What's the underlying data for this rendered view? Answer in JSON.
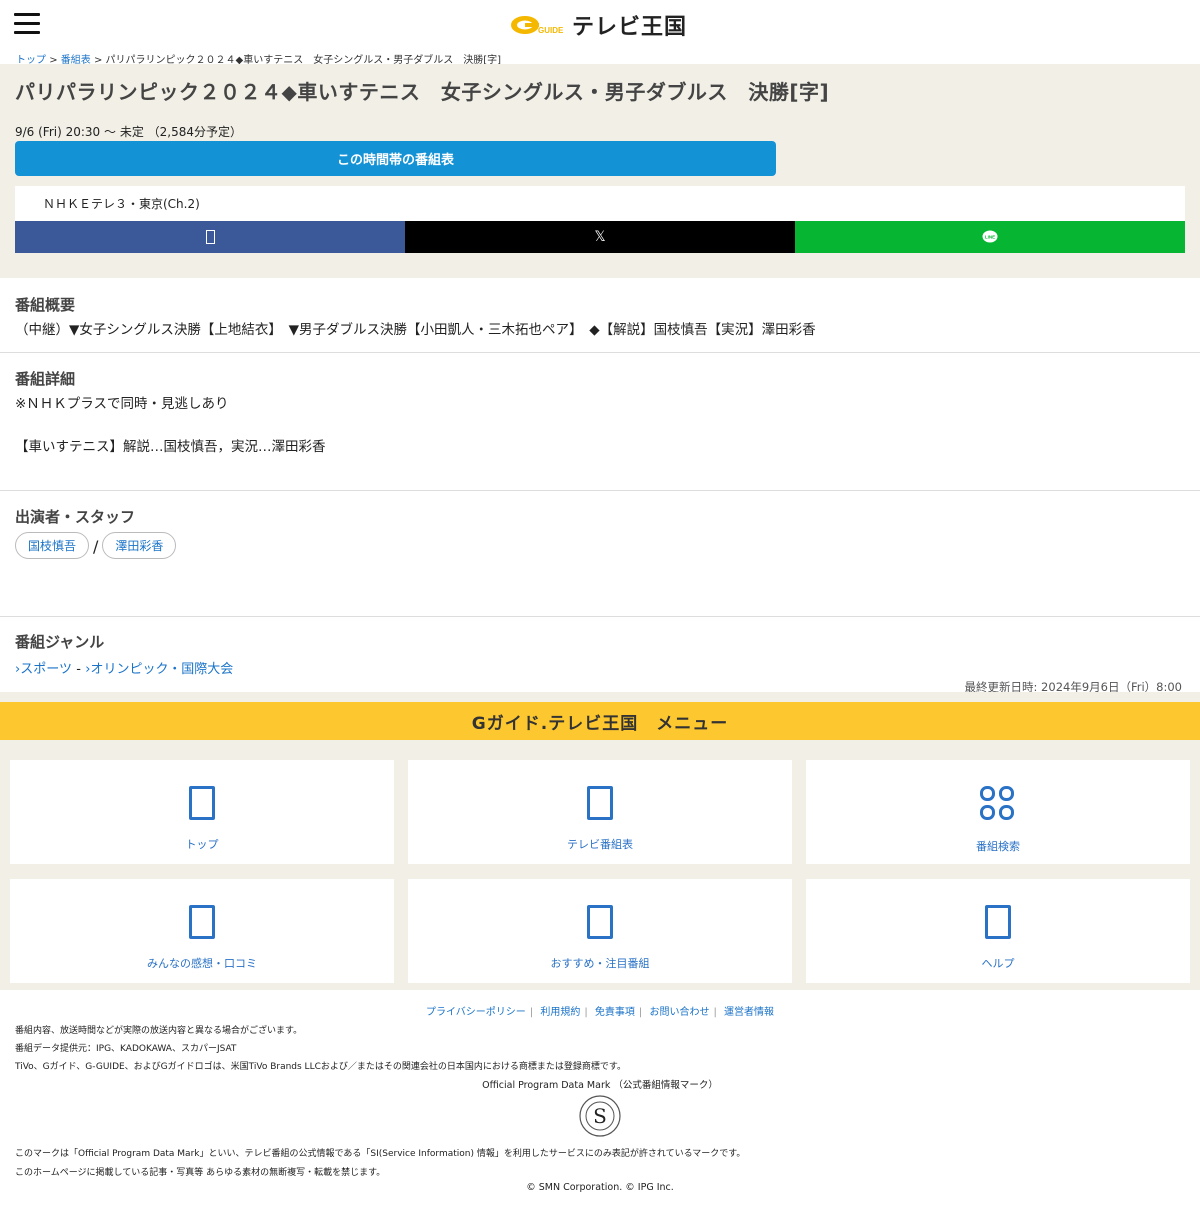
{
  "header": {
    "logo_text": "テレビ王国",
    "logo_sub": "GUIDE"
  },
  "breadcrumb": {
    "items": [
      "トップ",
      "番組表",
      "パリパラリンピック２０２４◆車いすテニス　女子シングルス・男子ダブルス　決勝[字]"
    ]
  },
  "program": {
    "title": "パリパラリンピック２０２４◆車いすテニス　女子シングルス・男子ダブルス　決勝[字]",
    "time": "9/6 (Fri) 20:30 〜 未定 （2,584分予定）",
    "timetable_button": "この時間帯の番組表",
    "channel": "ＮＨＫＥテレ３・東京(Ch.2)",
    "share": {
      "facebook_icon": "facebook-icon",
      "x_label": "𝕏",
      "line_label": "LINE"
    }
  },
  "summary": {
    "title": "番組概要",
    "text": "（中継）▼女子シングルス決勝【上地結衣】　▼男子ダブルス決勝【小田凱人・三木拓也ペア】　◆【解説】国枝慎吾【実況】澤田彩香"
  },
  "details": {
    "title": "番組詳細",
    "line1": "※ＮＨＫプラスで同時・見逃しあり",
    "line2": "【車いすテニス】解説…国枝慎吾，実況…澤田彩香"
  },
  "cast": {
    "title": "出演者・スタッフ",
    "people": [
      "国枝慎吾",
      "澤田彩香"
    ],
    "separator": "/"
  },
  "genre": {
    "title": "番組ジャンル",
    "primary": "スポーツ",
    "dash": "-",
    "secondary": "オリンピック・国際大会"
  },
  "updated": "最終更新日時: 2024年9月6日（Fri）8:00",
  "menu": {
    "title": "Gガイド.テレビ王国　メニュー",
    "items": [
      {
        "label": "トップ",
        "icon": "home-icon"
      },
      {
        "label": "テレビ番組表",
        "icon": "tv-guide-icon"
      },
      {
        "label": "番組検索",
        "icon": "search-grid-icon"
      },
      {
        "label": "みんなの感想・口コミ",
        "icon": "comment-icon"
      },
      {
        "label": "おすすめ・注目番組",
        "icon": "recommend-icon"
      },
      {
        "label": "ヘルプ",
        "icon": "help-icon"
      }
    ]
  },
  "footer": {
    "links": [
      "プライバシーポリシー",
      "利用規約",
      "免責事項",
      "お問い合わせ",
      "運営者情報"
    ],
    "note1": "番組内容、放送時間などが実際の放送内容と異なる場合がございます。",
    "note2": "番組データ提供元：IPG、KADOKAWA、スカパーJSAT",
    "note3": "TiVo、Gガイド、G-GUIDE、およびGガイドロゴは、米国TiVo Brands LLCおよび／またはその関連会社の日本国内における商標または登録商標です。",
    "opdm_label": "Official Program Data Mark （公式番組情報マーク）",
    "opdm_note": "このマークは「Official Program Data Mark」といい、テレビ番組の公式情報である「SI(Service Information) 情報」を利用したサービスにのみ表記が許されているマークです。",
    "copy_note": "このホームページに掲載している記事・写真等 あらゆる素材の無断複写・転載を禁じます。",
    "copyright": "© SMN Corporation. © IPG Inc."
  },
  "colors": {
    "accent_blue": "#1492d6",
    "menu_yellow": "#fdc82f",
    "beige": "#f1efe6",
    "facebook": "#3b5998",
    "x": "#000000",
    "line": "#06b531"
  }
}
